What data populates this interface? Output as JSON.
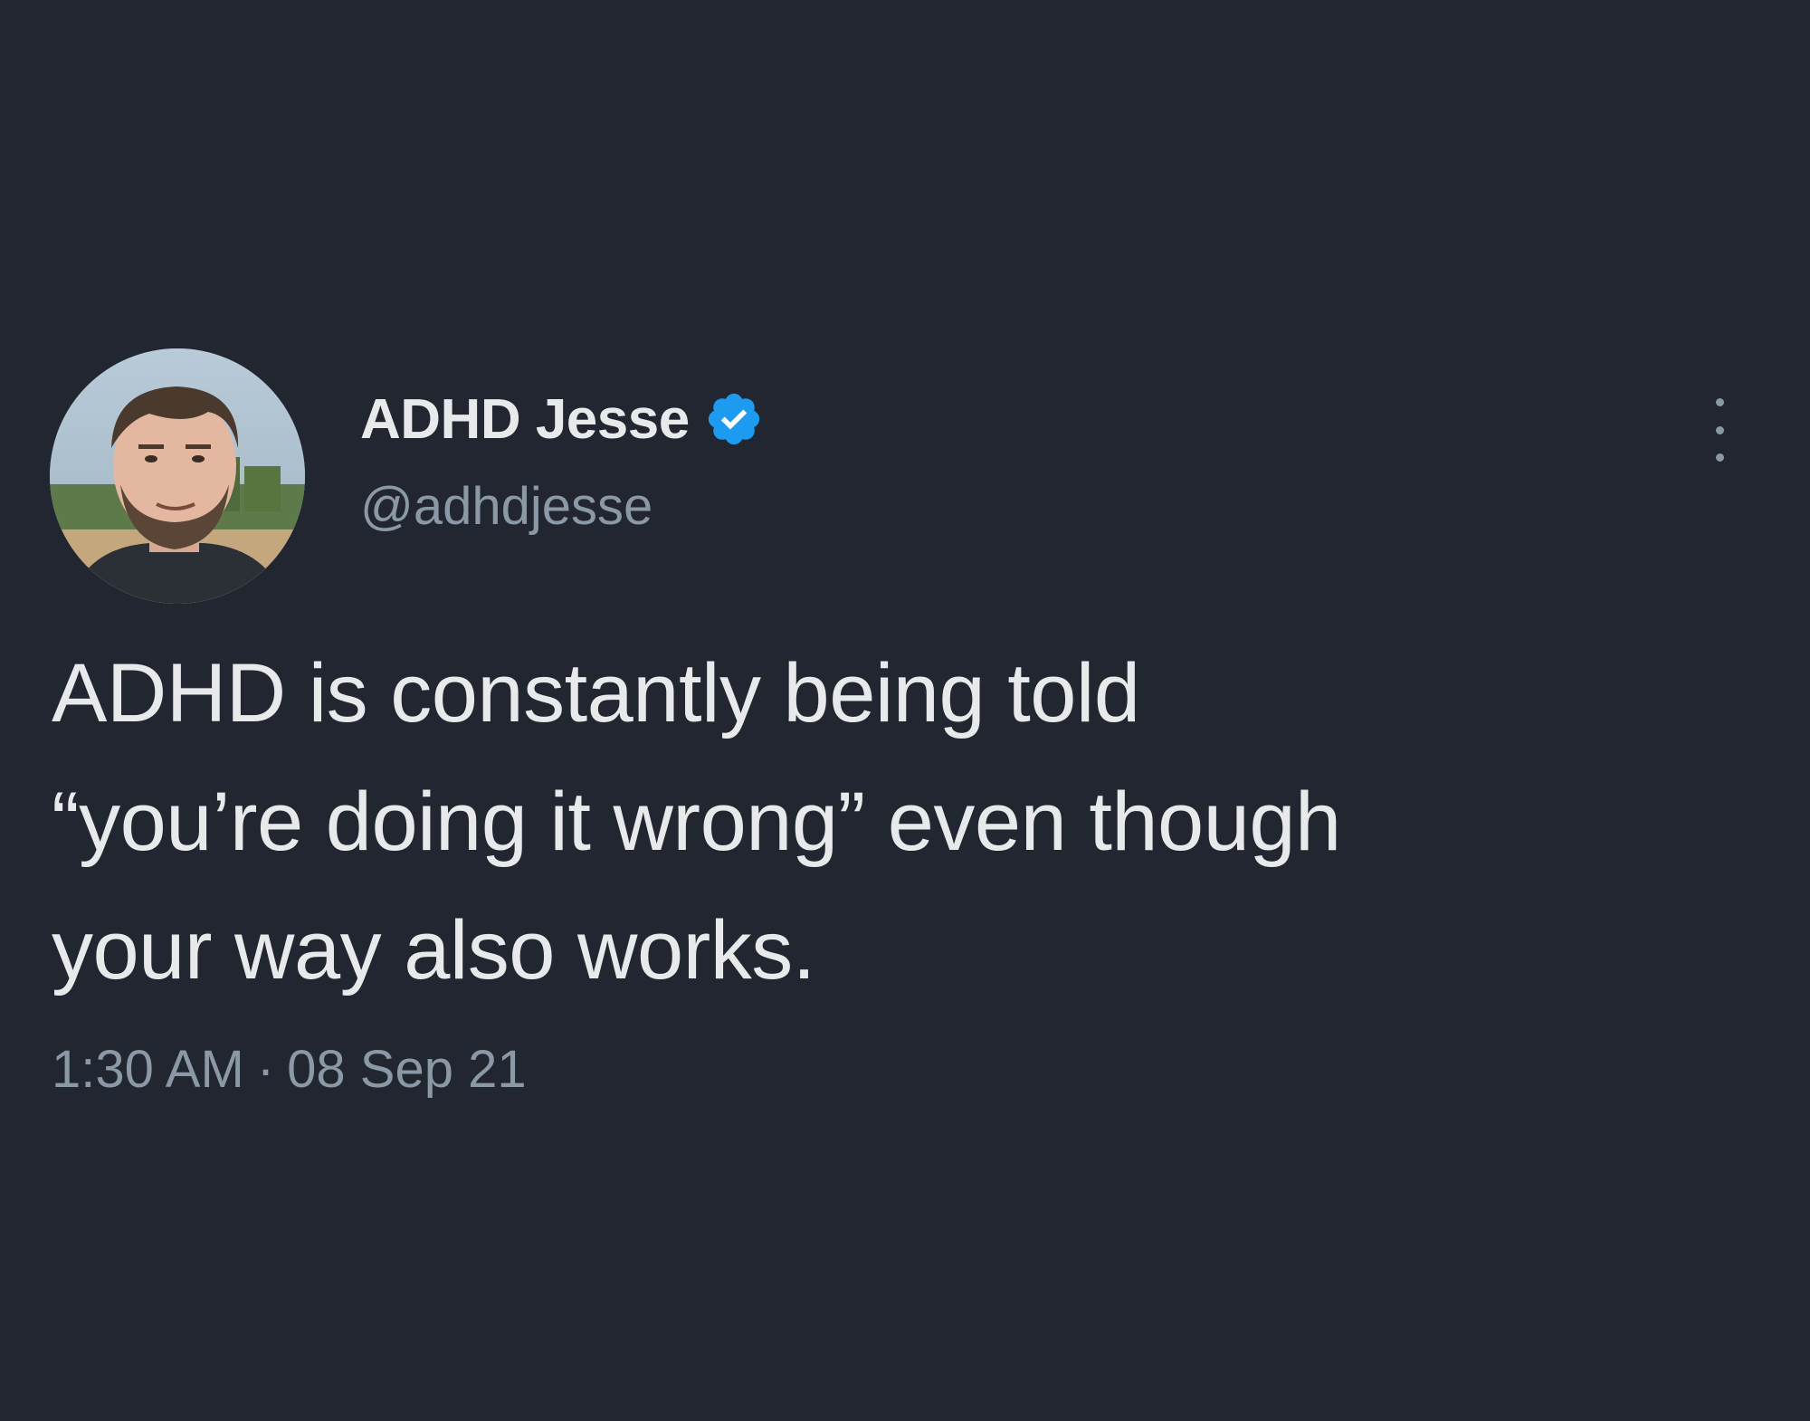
{
  "tweet": {
    "author": {
      "display_name": "ADHD Jesse",
      "handle": "@adhdjesse",
      "verified": true,
      "avatar_icon": "profile-photo"
    },
    "body_lines": [
      "ADHD is constantly being told",
      "“you’re doing it wrong” even though",
      "your way also works."
    ],
    "time": "1:30 AM",
    "separator": "·",
    "date": "08 Sep 21",
    "more_icon": "more-vertical-icon"
  },
  "colors": {
    "background": "#212630",
    "primary_text": "#e7e9ea",
    "secondary_text": "#8b98a5",
    "verified_badge": "#1d9bf0"
  }
}
